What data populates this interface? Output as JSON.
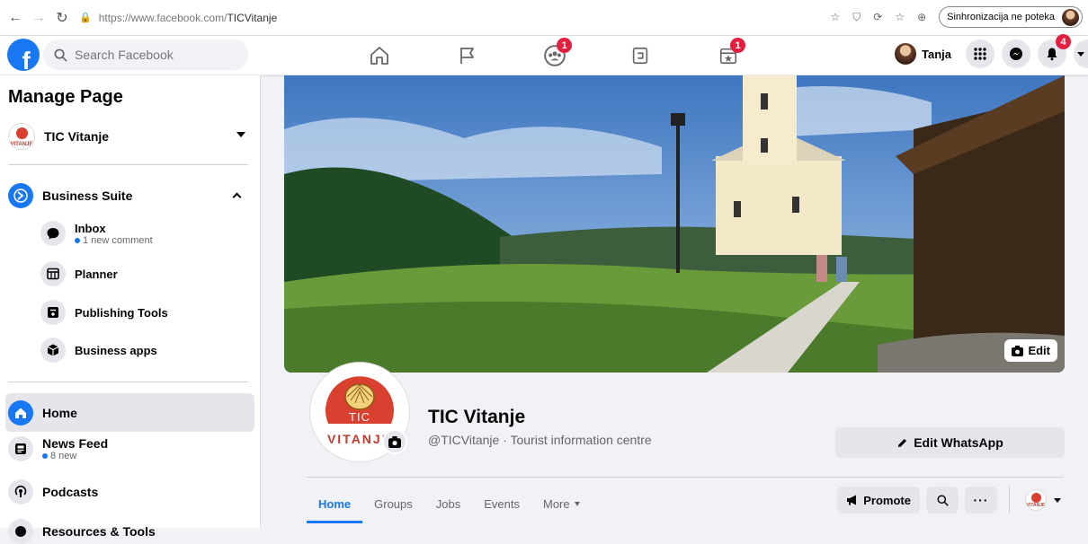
{
  "browser": {
    "url_prefix": "https://www.facebook.com/",
    "url_path": "TICVitanje",
    "sync_label": "Sinhronizacija ne poteka"
  },
  "topbar": {
    "search_placeholder": "Search Facebook",
    "groups_badge": "1",
    "pages_badge": "1",
    "user_name": "Tanja",
    "notifications_badge": "4"
  },
  "sidebar": {
    "title": "Manage Page",
    "page_name": "TIC Vitanje",
    "suite_label": "Business Suite",
    "items": [
      {
        "label": "Inbox",
        "sub": "1 new comment"
      },
      {
        "label": "Planner"
      },
      {
        "label": "Publishing Tools"
      },
      {
        "label": "Business apps"
      }
    ],
    "nav": [
      {
        "label": "Home"
      },
      {
        "label": "News Feed",
        "sub": "8 new"
      },
      {
        "label": "Podcasts"
      },
      {
        "label": "Resources & Tools"
      }
    ]
  },
  "logo": {
    "tic": "TIC",
    "vitanje": "VITANJE"
  },
  "cover": {
    "edit_label": "Edit"
  },
  "page": {
    "name": "TIC Vitanje",
    "handle_category": "@TICVitanje · Tourist information centre",
    "whatsapp_label": "Edit WhatsApp"
  },
  "tabs": [
    "Home",
    "Groups",
    "Jobs",
    "Events",
    "More"
  ],
  "actions": {
    "promote_label": "Promote"
  }
}
